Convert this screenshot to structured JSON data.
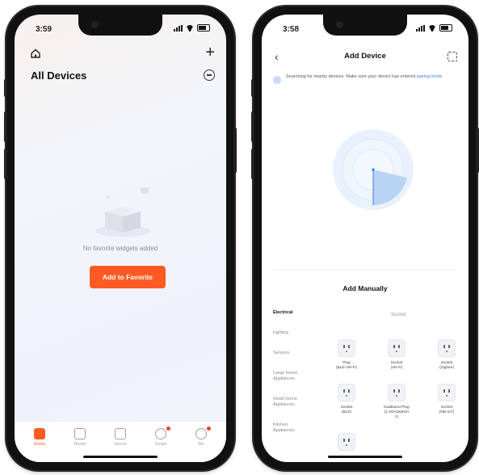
{
  "left_phone": {
    "status_time": "3:59",
    "title": "All Devices",
    "empty_text": "No favorite widgets added",
    "add_button": "Add to Favorite",
    "plus_icon": "+",
    "tabs": [
      {
        "label": "Home",
        "active": true,
        "badge": false
      },
      {
        "label": "Room",
        "active": false,
        "badge": false
      },
      {
        "label": "Scene",
        "active": false,
        "badge": false
      },
      {
        "label": "Smart",
        "active": false,
        "badge": true
      },
      {
        "label": "Me",
        "active": false,
        "badge": true
      }
    ],
    "accent": "#ff5a22"
  },
  "right_phone": {
    "status_time": "3:58",
    "back_icon": "‹",
    "title": "Add Device",
    "searching_text": "Searching for nearby devices. Make sure your device has entered",
    "searching_link": "pairing mode",
    "manual_title": "Add Manually",
    "categories": [
      "Electrical",
      "Lighting",
      "Sensors",
      "Large Home Appliances",
      "Small Home Appliances",
      "Kitchen Appliances"
    ],
    "active_category": "Electrical",
    "sub_heading": "Socket",
    "devices": [
      {
        "name": "Plug\n(BLE+Wi-Fi)"
      },
      {
        "name": "Socket\n(Wi-Fi)"
      },
      {
        "name": "Socket\n(Zigbee)"
      },
      {
        "name": "Socket\n(BLE)"
      },
      {
        "name": "Dualband Plug\n(2.4GHz&5GH\nz)"
      },
      {
        "name": "Socket\n(NB-IoT)"
      },
      {
        "name": ""
      }
    ],
    "link_color": "#3a7de8"
  }
}
